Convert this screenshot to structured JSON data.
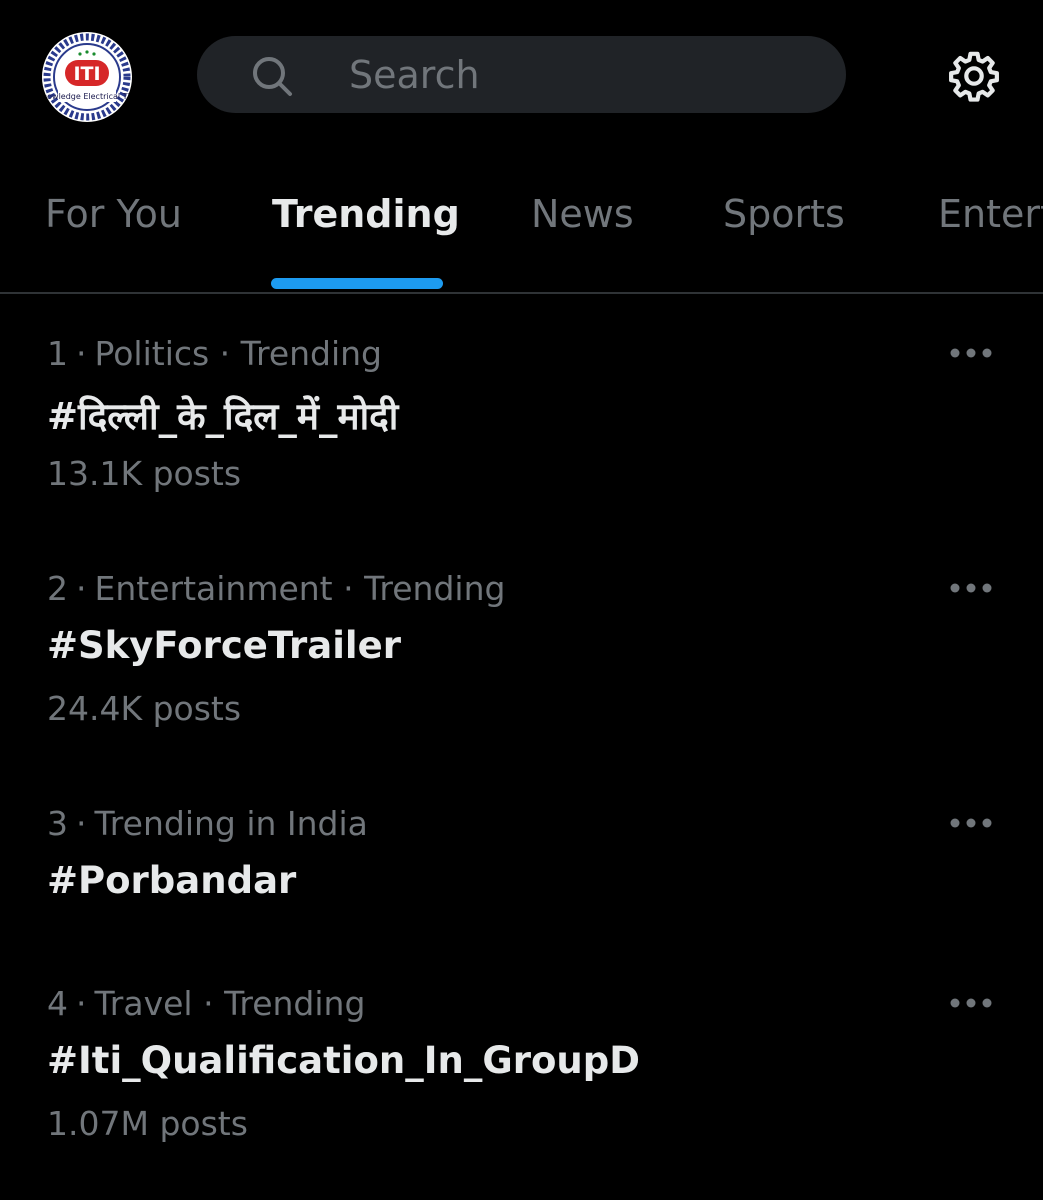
{
  "header": {
    "logo_text": "ITI",
    "logo_ring_text": "INDUSTRIAL TRAINING INSTITUTE",
    "logo_bottom_text": "VK Knowledge Electrical Theory",
    "search_placeholder": "Search",
    "icons": [
      "search-icon",
      "gear-icon"
    ]
  },
  "tabs": [
    {
      "label": "For You",
      "active": false
    },
    {
      "label": "Trending",
      "active": true
    },
    {
      "label": "News",
      "active": false
    },
    {
      "label": "Sports",
      "active": false
    },
    {
      "label": "Entert",
      "active": false
    }
  ],
  "trends": [
    {
      "rank": "1",
      "context": "Politics · Trending",
      "tag": "#दिल्ली_के_दिल_में_मोदी",
      "posts": "13.1K posts"
    },
    {
      "rank": "2",
      "context": "Entertainment · Trending",
      "tag": "#SkyForceTrailer",
      "posts": "24.4K posts"
    },
    {
      "rank": "3",
      "context": "Trending in India",
      "tag": "#Porbandar",
      "posts": ""
    },
    {
      "rank": "4",
      "context": "Travel · Trending",
      "tag": "#Iti_Qualification_In_GroupD",
      "posts": "1.07M posts"
    }
  ],
  "colors": {
    "background": "#000000",
    "accent": "#1d9bf0",
    "muted": "#71767b",
    "text": "#e7e9ea"
  }
}
